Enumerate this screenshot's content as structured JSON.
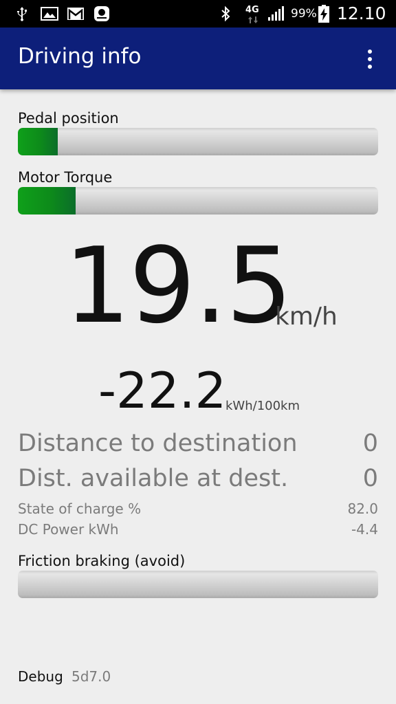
{
  "status_bar": {
    "network_type": "4G",
    "battery_percent": "99%",
    "time": "12.10",
    "icons": [
      "usb-icon",
      "gallery-icon",
      "gmail-icon",
      "galaxy-app-icon",
      "bluetooth-icon",
      "signal-icon",
      "battery-charging-icon"
    ]
  },
  "app_bar": {
    "title": "Driving info",
    "menu_icon": "overflow-menu-icon"
  },
  "pedal": {
    "label": "Pedal position",
    "fraction": 0.11
  },
  "torque": {
    "label": "Motor Torque",
    "fraction": 0.16
  },
  "speed": {
    "value": "19.5",
    "unit": "km/h"
  },
  "consumption": {
    "value": "-22.2",
    "unit": "kWh/100km"
  },
  "rows": [
    {
      "label": "Distance to destination",
      "value": "0"
    },
    {
      "label": "Dist. available at dest.",
      "value": "0"
    }
  ],
  "small_rows": [
    {
      "label": "State of charge %",
      "value": "82.0"
    },
    {
      "label": "DC Power kWh",
      "value": "-4.4"
    }
  ],
  "friction": {
    "label": "Friction braking (avoid)",
    "fraction": 0
  },
  "debug": {
    "label": "Debug",
    "value": "5d7.0"
  },
  "colors": {
    "app_bar": "#0d1f7a",
    "bar_fill": "#0d8b1a",
    "background": "#eeeeee",
    "muted_text": "#7b7b7b"
  }
}
